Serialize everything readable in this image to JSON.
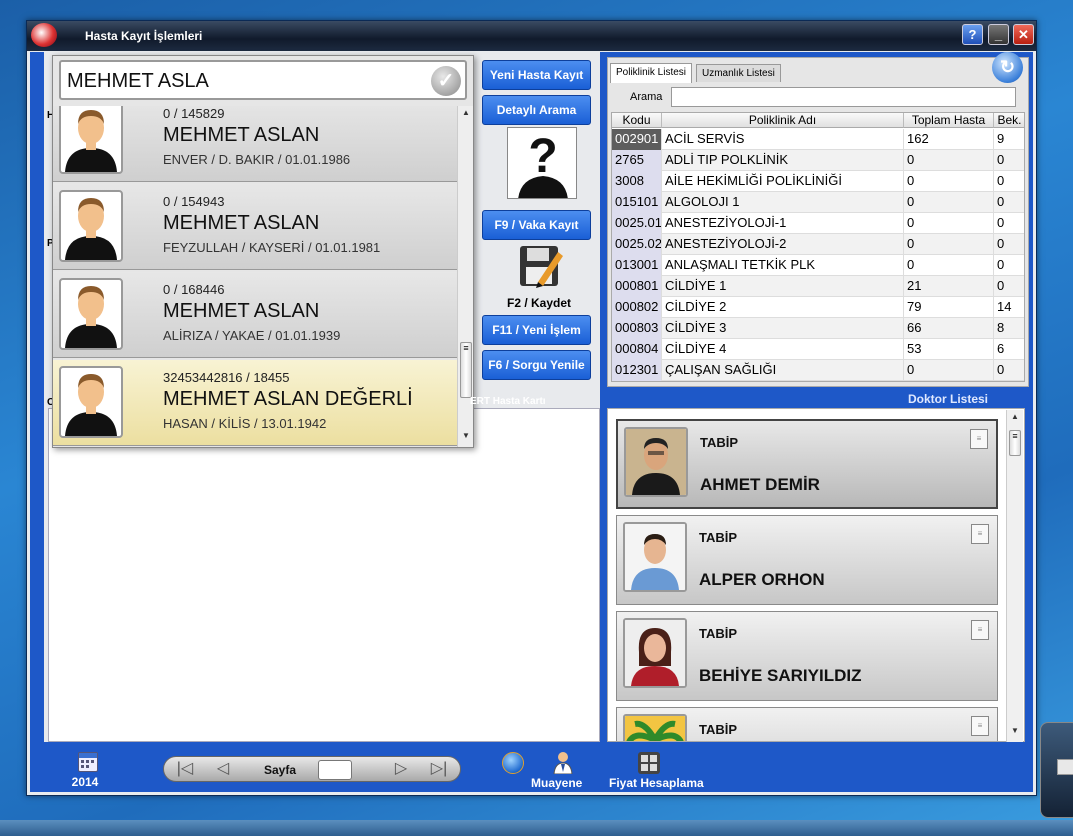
{
  "window": {
    "title": "Hasta Kayıt İşlemleri"
  },
  "search": {
    "value": "MEHMET ASLA"
  },
  "patients": [
    {
      "id": "0 / 145829",
      "name": "MEHMET ASLAN",
      "info": "ENVER / D. BAKIR / 01.01.1986"
    },
    {
      "id": "0 / 154943",
      "name": "MEHMET ASLAN",
      "info": "FEYZULLAH / KAYSERİ / 01.01.1981"
    },
    {
      "id": "0 / 168446",
      "name": "MEHMET ASLAN",
      "info": "ALİRIZA / YAKAE / 01.01.1939"
    },
    {
      "id": "32453442816 / 18455",
      "name": "MEHMET ASLAN DEĞERLİ",
      "info": "HASAN / KİLİS / 13.01.1942"
    }
  ],
  "buttons": {
    "new_patient": "Yeni Hasta Kayıt",
    "detailed_search": "Detaylı Arama",
    "case_record": "F9 / Vaka Kayıt",
    "save": "F2 / Kaydet",
    "new_process": "F11 / Yeni İşlem",
    "refresh_query": "F6 / Sorgu Yenile"
  },
  "ert_label": "ERT Hasta Kartı",
  "polyclinic": {
    "tabs": [
      "Poliklinik Listesi",
      "Uzmanlık Listesi"
    ],
    "search_label": "Arama",
    "columns": [
      "Kodu",
      "Poliklinik Adı",
      "Toplam Hasta",
      "Bek."
    ],
    "rows": [
      [
        "002901",
        "ACİL SERVİS",
        "162",
        "9"
      ],
      [
        "2765",
        "ADLİ TIP POLKLİNİK",
        "0",
        "0"
      ],
      [
        "3008",
        "AİLE HEKİMLİĞİ POLİKLİNİĞİ",
        "0",
        "0"
      ],
      [
        "015101",
        "ALGOLOJI 1",
        "0",
        "0"
      ],
      [
        "0025.01",
        "ANESTEZİYOLOJİ-1",
        "0",
        "0"
      ],
      [
        "0025.02",
        "ANESTEZİYOLOJİ-2",
        "0",
        "0"
      ],
      [
        "013001",
        "ANLAŞMALI TETKİK PLK",
        "0",
        "0"
      ],
      [
        "000801",
        "CİLDİYE 1",
        "21",
        "0"
      ],
      [
        "000802",
        "CİLDİYE 2",
        "79",
        "14"
      ],
      [
        "000803",
        "CİLDİYE 3",
        "66",
        "8"
      ],
      [
        "000804",
        "CİLDİYE 4",
        "53",
        "6"
      ],
      [
        "012301",
        "ÇALIŞAN SAĞLIĞI",
        "0",
        "0"
      ]
    ]
  },
  "doctor_list": {
    "title": "Doktor Listesi",
    "doctors": [
      {
        "role": "TABİP",
        "name": "AHMET DEMİR"
      },
      {
        "role": "TABİP",
        "name": "ALPER ORHON"
      },
      {
        "role": "TABİP",
        "name": "BEHİYE SARIYILDIZ"
      },
      {
        "role": "TABİP",
        "name": ""
      }
    ]
  },
  "bottom": {
    "year": "2014",
    "page_label": "Sayfa",
    "exam": "Muayene",
    "price_calc": "Fiyat Hesaplama"
  }
}
